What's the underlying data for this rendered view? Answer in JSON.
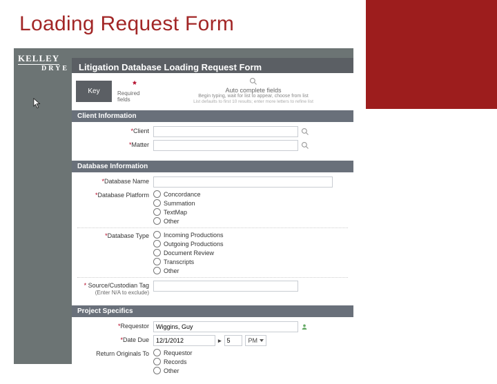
{
  "slide": {
    "title": "Loading Request Form"
  },
  "logo": {
    "line1": "KELLEY",
    "line2": "DRYE"
  },
  "form": {
    "banner": "Litigation Database Loading Request Form",
    "key": {
      "heading": "Key",
      "required_star": "*",
      "required_label": "Required fields",
      "search_icon": "search",
      "auto_title": "Auto complete fields",
      "auto_sub1": "Begin typing, wait for list to appear, choose from list",
      "auto_sub2": "List defaults to first 10 results; enter more letters to refine list"
    },
    "sections": {
      "client": {
        "head": "Client Information",
        "fields": {
          "client_label": "Client",
          "matter_label": "Matter"
        }
      },
      "database": {
        "head": "Database Information",
        "fields": {
          "name_label": "Database Name",
          "platform_label": "Database Platform",
          "platform_opts": [
            "Concordance",
            "Summation",
            "TextMap",
            "Other"
          ],
          "type_label": "Database Type",
          "type_opts": [
            "Incoming Productions",
            "Outgoing Productions",
            "Document Review",
            "Transcripts",
            "Other"
          ],
          "source_label": "Source/Custodian Tag",
          "source_hint": "(Enter N/A to exclude)"
        }
      },
      "project": {
        "head": "Project Specifics",
        "fields": {
          "requestor_label": "Requestor",
          "requestor_value": "Wiggins, Guy",
          "due_label": "Date Due",
          "due_value": "12/1/2012",
          "due_hour": "5",
          "due_ampm": "PM",
          "return_label": "Return Originals To",
          "return_opts": [
            "Requestor",
            "Records",
            "Other"
          ]
        }
      }
    }
  }
}
